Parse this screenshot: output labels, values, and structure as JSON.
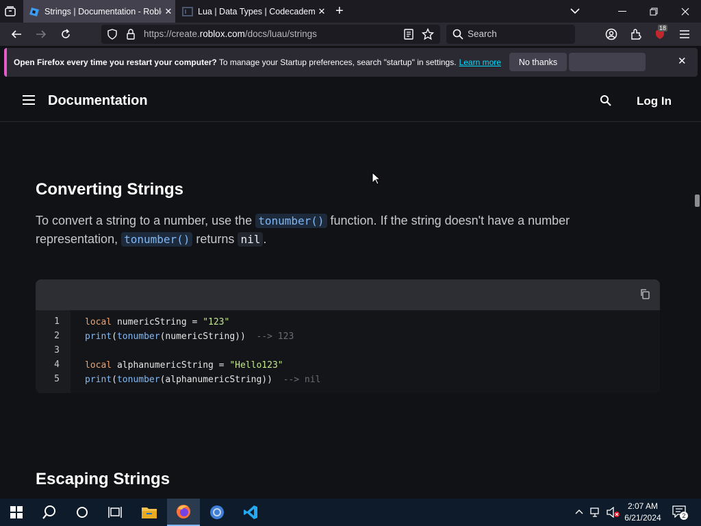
{
  "browser": {
    "tabs": [
      {
        "title": "Strings | Documentation - Roblo",
        "active": true
      },
      {
        "title": "Lua | Data Types | Codecademy",
        "active": false
      }
    ],
    "url_prefix": "https://create.",
    "url_domain": "roblox.com",
    "url_path": "/docs/luau/strings",
    "search_placeholder": "Search",
    "extension_badge": "18"
  },
  "notification": {
    "bold": "Open Firefox every time you restart your computer?",
    "text": " To manage your Startup preferences, search \"startup\" in settings.",
    "link": "Learn more",
    "button": "No thanks"
  },
  "header": {
    "title": "Documentation",
    "login": "Log In"
  },
  "content": {
    "section_title": "Converting Strings",
    "para_parts": {
      "p1": "To convert a string to a number, use the ",
      "c1": "tonumber()",
      "p2": " function. If the string doesn't have a number representation, ",
      "c2": "tonumber()",
      "p3": " returns ",
      "c3": "nil",
      "p4": "."
    },
    "code_lines": [
      {
        "num": "1",
        "text": "local numericString = \"123\""
      },
      {
        "num": "2",
        "text": "print(tonumber(numericString))  --> 123"
      },
      {
        "num": "3",
        "text": ""
      },
      {
        "num": "4",
        "text": "local alphanumericString = \"Hello123\""
      },
      {
        "num": "5",
        "text": "print(tonumber(alphanumericString))  --> nil"
      }
    ],
    "next_section_title": "Escaping Strings"
  },
  "taskbar": {
    "time": "2:07 AM",
    "date": "6/21/2024",
    "notification_count": "2"
  },
  "colors": {
    "page_bg": "#111216",
    "accent_link": "#00ddff",
    "notif_border": "#e45cc7"
  }
}
